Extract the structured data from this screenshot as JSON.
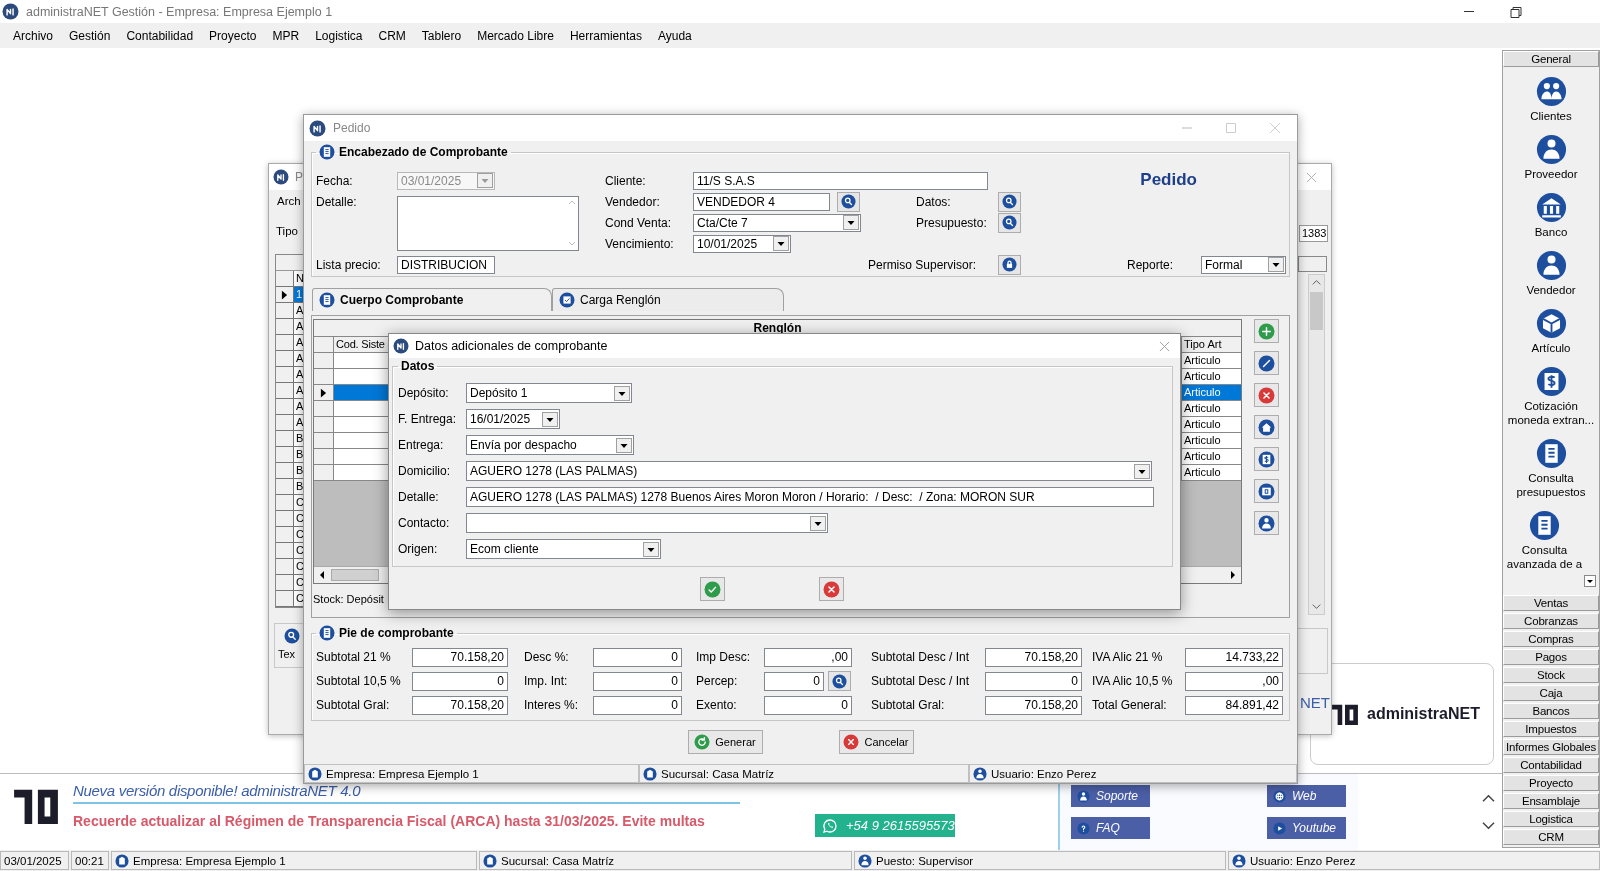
{
  "app": {
    "title": "administraNET Gestión - Empresa: Empresa Ejemplo 1"
  },
  "menu": [
    "Archivo",
    "Gestión",
    "Contabilidad",
    "Proyecto",
    "MPR",
    "Logistica",
    "CRM",
    "Tablero",
    "Mercado Libre",
    "Herramientas",
    "Ayuda"
  ],
  "back_window": {
    "title": "P",
    "menu_item": "Arch",
    "field_label": "Tipo",
    "number": "1383",
    "key_header": "N",
    "rows": [
      {
        "key": "1",
        "selected": true
      },
      {
        "key": "A",
        "selected": false
      },
      {
        "key": "A",
        "selected": false
      },
      {
        "key": "A",
        "selected": false
      },
      {
        "key": "A",
        "selected": false
      },
      {
        "key": "A",
        "selected": false
      },
      {
        "key": "A",
        "selected": false
      },
      {
        "key": "A",
        "selected": false
      },
      {
        "key": "A",
        "selected": false
      },
      {
        "key": "B",
        "selected": false
      },
      {
        "key": "B",
        "selected": false
      },
      {
        "key": "B",
        "selected": false
      },
      {
        "key": "B",
        "selected": false
      },
      {
        "key": "C",
        "selected": false
      },
      {
        "key": "C",
        "selected": false
      },
      {
        "key": "C",
        "selected": false
      },
      {
        "key": "C",
        "selected": false
      },
      {
        "key": "C",
        "selected": false
      },
      {
        "key": "C",
        "selected": false
      },
      {
        "key": "C",
        "selected": false
      }
    ],
    "text_label": "Tex",
    "logo_text": "NET"
  },
  "pedido": {
    "title": "Pedido",
    "header": {
      "title": "Encabezado de Comprobante",
      "heading": "Pedido",
      "fields": [
        {
          "label": "Fecha:",
          "value": "03/01/2025",
          "kind": "date",
          "disabled": true
        },
        {
          "label": "Detalle:",
          "kind": "memo",
          "disabled": false
        },
        {
          "label": "Lista precio:",
          "value": "DISTRIBUCION",
          "kind": "text",
          "disabled": false
        },
        {
          "label": "Cliente:",
          "value": "11/S S.A.S",
          "kind": "text",
          "disabled": false
        },
        {
          "label": "Vendedor:",
          "value": "VENDEDOR 4",
          "kind": "lookup",
          "disabled": false
        },
        {
          "label": "Cond Venta:",
          "value": "Cta/Cte 7",
          "kind": "combo",
          "disabled": false
        },
        {
          "label": "Vencimiento:",
          "value": "10/01/2025",
          "kind": "date",
          "disabled": false
        },
        {
          "label": "Datos:",
          "kind": "button",
          "disabled": false
        },
        {
          "label": "Presupuesto:",
          "kind": "button",
          "disabled": false
        },
        {
          "label": "Permiso Supervisor:",
          "kind": "lock",
          "disabled": false
        },
        {
          "label": "Reporte:",
          "value": "Formal",
          "kind": "combo",
          "disabled": false
        }
      ]
    },
    "tabs": [
      {
        "label": "Cuerpo Comprobante",
        "selected": true
      },
      {
        "label": "Carga Renglón",
        "selected": false
      }
    ],
    "lines": {
      "title": "Renglón",
      "columns": [
        "Cod. Siste",
        "Tipo Art"
      ],
      "rows": [
        {
          "tipo_art": "Articulo",
          "selected": false
        },
        {
          "tipo_art": "Articulo",
          "selected": false
        },
        {
          "tipo_art": "Articulo",
          "selected": true
        },
        {
          "tipo_art": "Articulo",
          "selected": false
        },
        {
          "tipo_art": "Articulo",
          "selected": false
        },
        {
          "tipo_art": "Articulo",
          "selected": false
        },
        {
          "tipo_art": "Articulo",
          "selected": false
        },
        {
          "tipo_art": "Articulo",
          "selected": false
        }
      ],
      "stock_label": "Stock: Depósit"
    },
    "footer": {
      "title": "Pie de comprobante",
      "fields": [
        {
          "label": "Subtotal 21 %",
          "value": "70.158,20",
          "kind": "plain"
        },
        {
          "label": "Desc %:",
          "value": "0",
          "kind": "plain"
        },
        {
          "label": "Imp Desc:",
          "value": ",00",
          "kind": "plain"
        },
        {
          "label": "Subtotal Desc / Int",
          "value": "70.158,20",
          "kind": "plain"
        },
        {
          "label": "IVA Alic 21 %",
          "value": "14.733,22",
          "kind": "plain"
        },
        {
          "label": "Subtotal 10,5 %",
          "value": "0",
          "kind": "plain"
        },
        {
          "label": "Imp. Int:",
          "value": "0",
          "kind": "plain"
        },
        {
          "label": "Percep:",
          "value": "0",
          "kind": "lookup"
        },
        {
          "label": "Subtotal Desc / Int",
          "value": "0",
          "kind": "plain"
        },
        {
          "label": "IVA Alic 10,5 %",
          "value": ",00",
          "kind": "plain"
        },
        {
          "label": "Subtotal Gral:",
          "value": "70.158,20",
          "kind": "plain"
        },
        {
          "label": "Interes %:",
          "value": "0",
          "kind": "plain"
        },
        {
          "label": "Exento:",
          "value": "0",
          "kind": "plain"
        },
        {
          "label": "Subtotal Gral:",
          "value": "70.158,20",
          "kind": "plain"
        },
        {
          "label": "Total General:",
          "value": "84.891,42",
          "kind": "plain"
        }
      ]
    },
    "buttons": [
      {
        "label": "Generar",
        "kind": "ok"
      },
      {
        "label": "Cancelar",
        "kind": "cancel"
      }
    ],
    "status": [
      "Empresa: Empresa Ejemplo 1",
      "Sucursal: Casa Matríz",
      "Usuario: Enzo Perez"
    ]
  },
  "dialog": {
    "title": "Datos adicionales de comprobante",
    "group": "Datos",
    "fields": [
      {
        "label": "Depósito:",
        "value": "Depósito 1",
        "kind": "combo"
      },
      {
        "label": "F. Entrega:",
        "value": "16/01/2025",
        "kind": "date"
      },
      {
        "label": "Entrega:",
        "value": "Envía por despacho",
        "kind": "combo"
      },
      {
        "label": "Domicilio:",
        "value": "AGUERO 1278 (LAS PALMAS)",
        "kind": "combo"
      },
      {
        "label": "Detalle:",
        "value": "AGUERO 1278 (LAS PALMAS) 1278 Buenos Aires Moron Moron / Horario:  / Desc:  / Zona: MORON SUR",
        "kind": "text"
      },
      {
        "label": "Contacto:",
        "kind": "combo"
      },
      {
        "label": "Origen:",
        "value": "Ecom cliente",
        "kind": "combo"
      }
    ]
  },
  "logo_panel": {
    "text": "administraNET"
  },
  "sidebar": {
    "header": "General",
    "items": [
      "Clientes",
      "Proveedor",
      "Banco",
      "Vendedor",
      "Artículo",
      "Cotización moneda extran...",
      "Consulta presupuestos",
      "Consulta avanzada de a"
    ],
    "sections": [
      "Ventas",
      "Cobranzas",
      "Compras",
      "Pagos",
      "Stock",
      "Caja",
      "Bancos",
      "Impuestos",
      "Informes Globales",
      "Contabilidad",
      "Proyecto",
      "Ensamblaje",
      "Logistica",
      "CRM"
    ]
  },
  "banner": {
    "title": "Nueva versión disponible! administraNET 4.0",
    "notice": "Recuerde actualizar al Régimen de Transparencia Fiscal (ARCA) hasta 31/03/2025. Evite multas",
    "whatsapp": "+54 9 2615595573",
    "links": [
      "Soporte",
      "Web",
      "FAQ",
      "Youtube"
    ]
  },
  "status": [
    "03/01/2025",
    "00:21",
    "Empresa: Empresa Ejemplo 1",
    "Sucursal: Casa Matríz",
    "Puesto: Supervisor",
    "Usuario: Enzo Perez"
  ]
}
